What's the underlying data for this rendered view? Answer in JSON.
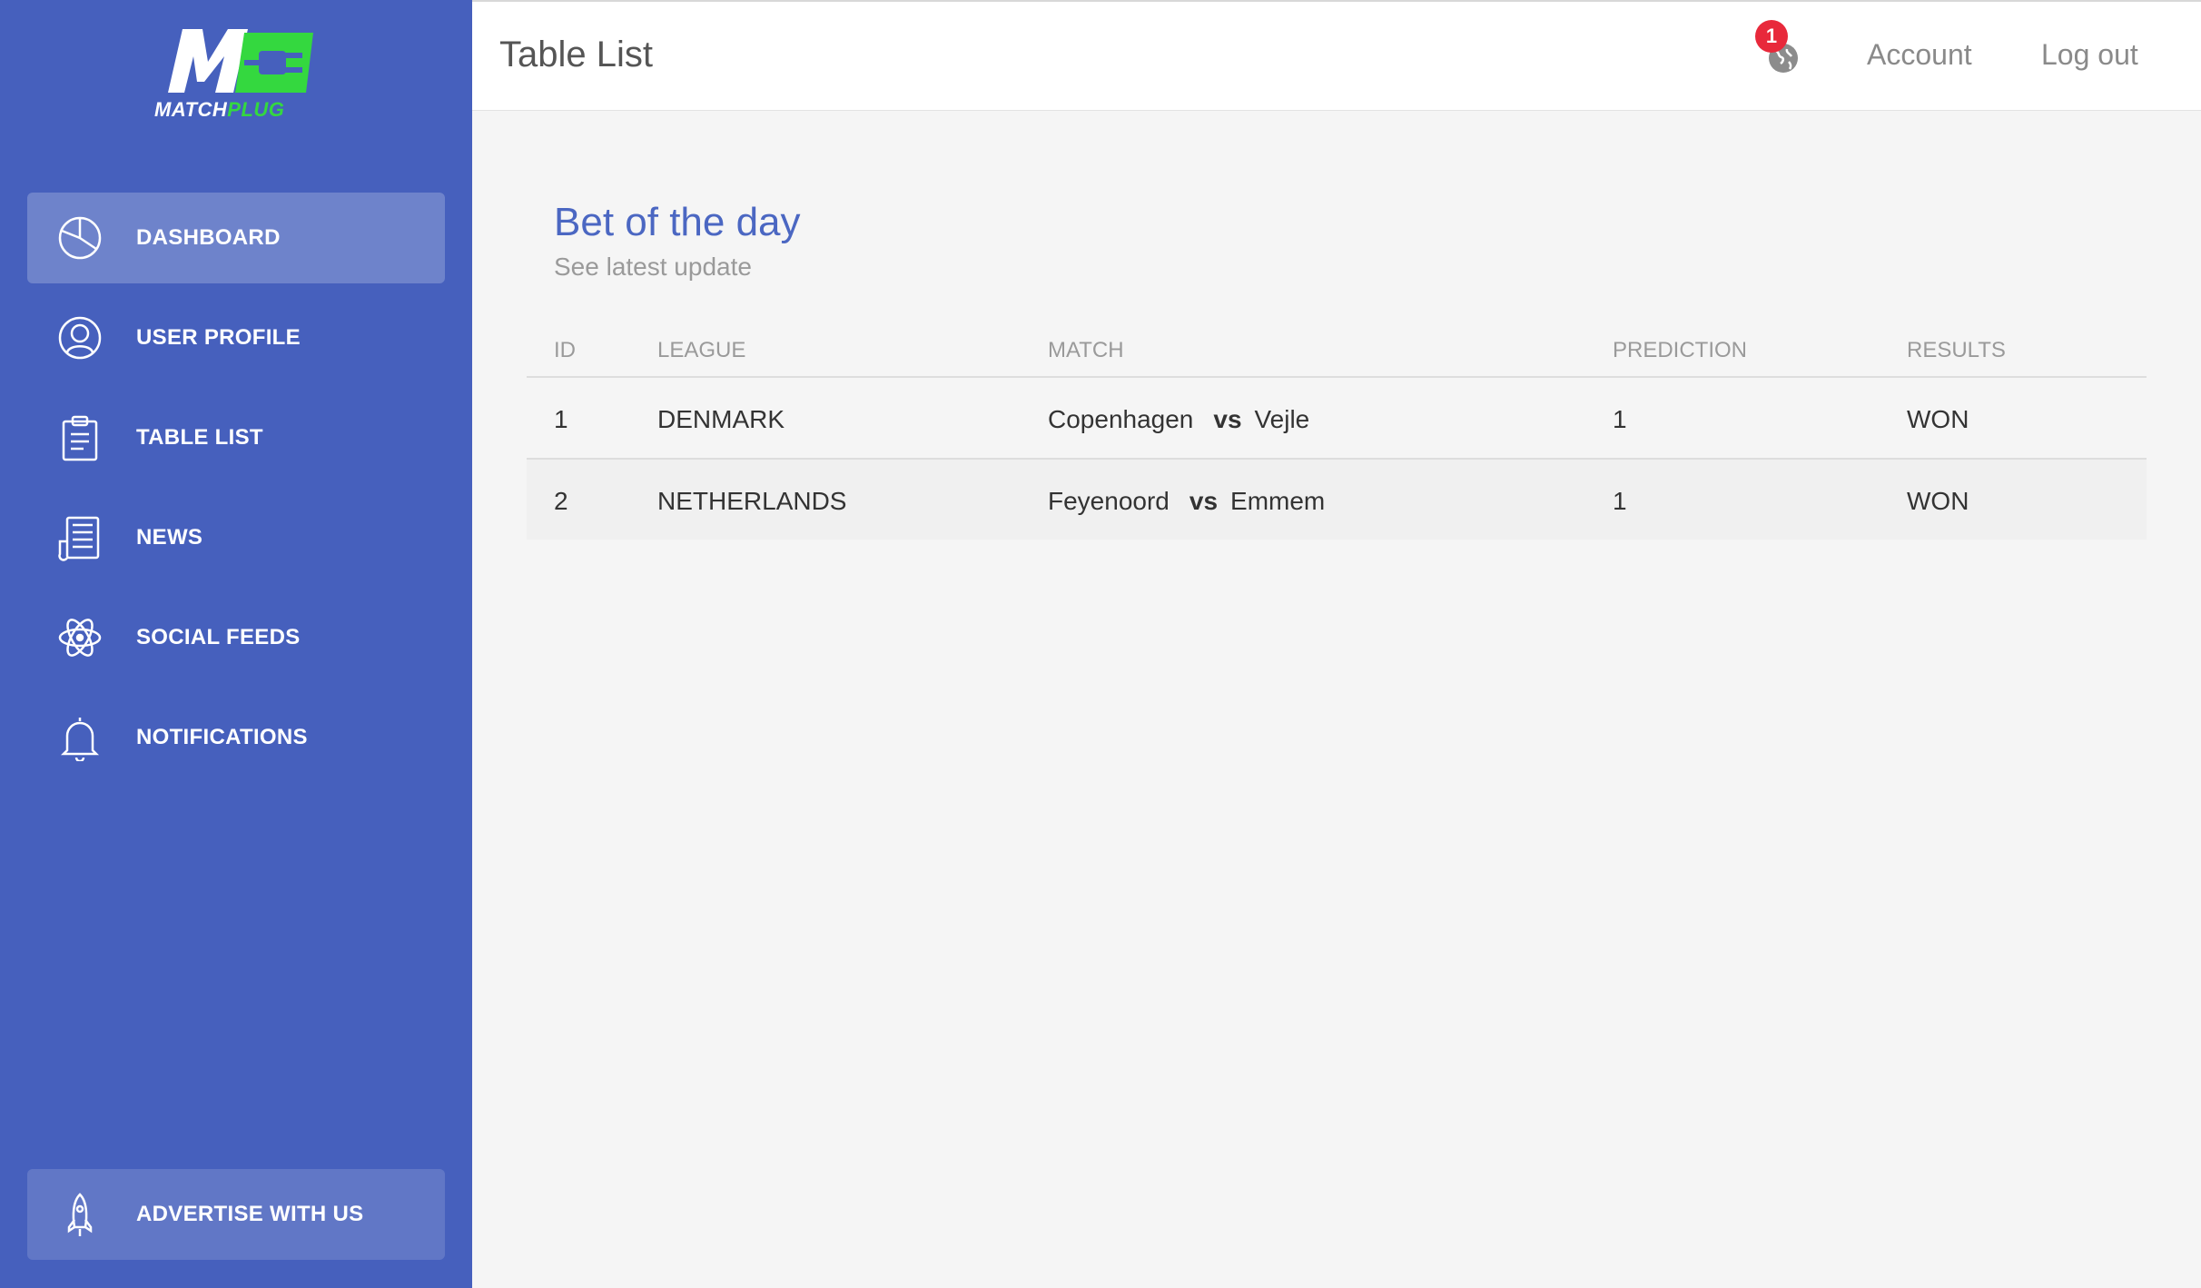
{
  "app": {
    "logo_text_part1": "MATCH",
    "logo_text_part2": "PLUG",
    "brand_color": "#4660bd",
    "accent_color": "#34d83f"
  },
  "sidebar": {
    "items": [
      {
        "label": "DASHBOARD",
        "icon": "pie-chart-icon",
        "active": true
      },
      {
        "label": "USER PROFILE",
        "icon": "user-icon",
        "active": false
      },
      {
        "label": "TABLE LIST",
        "icon": "clipboard-icon",
        "active": false
      },
      {
        "label": "NEWS",
        "icon": "newspaper-icon",
        "active": false
      },
      {
        "label": "SOCIAL FEEDS",
        "icon": "atom-icon",
        "active": false
      },
      {
        "label": "NOTIFICATIONS",
        "icon": "bell-icon",
        "active": false
      }
    ],
    "advertise": {
      "label": "ADVERTISE WITH US",
      "icon": "rocket-icon"
    }
  },
  "header": {
    "title": "Table List",
    "notification_count": "1",
    "account_label": "Account",
    "logout_label": "Log out"
  },
  "card": {
    "title": "Bet of the day",
    "subtitle": "See latest update",
    "columns": [
      "ID",
      "LEAGUE",
      "MATCH",
      "PREDICTION",
      "RESULTS"
    ],
    "vs_label": "vs",
    "rows": [
      {
        "id": "1",
        "league": "DENMARK",
        "home": "Copenhagen",
        "away": "Vejle",
        "prediction": "1",
        "result": "WON"
      },
      {
        "id": "2",
        "league": "NETHERLANDS",
        "home": "Feyenoord",
        "away": "Emmem",
        "prediction": "1",
        "result": "WON"
      }
    ]
  }
}
